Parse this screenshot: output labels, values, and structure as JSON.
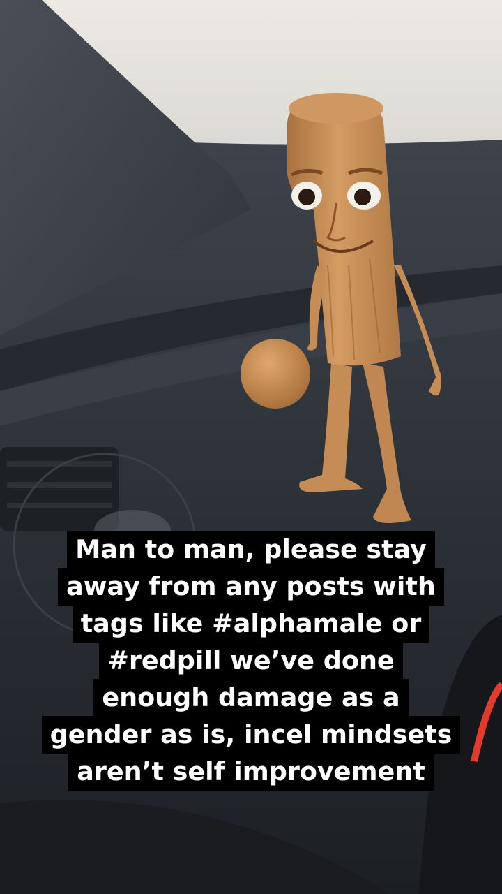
{
  "caption": {
    "lines": [
      "Man to man, please stay",
      "away from any posts with",
      "tags like #alphamale or",
      "#redpill we’ve done",
      "enough damage as a",
      "gender as is, incel mindsets",
      "aren’t self improvement"
    ]
  },
  "scene": {
    "character": "wooden-stick-man",
    "setting": "car-dashboard"
  },
  "colors": {
    "caption_background": "#000000",
    "caption_text": "#ffffff",
    "character_wood": "#c8915a",
    "dashboard": "#33373e"
  }
}
